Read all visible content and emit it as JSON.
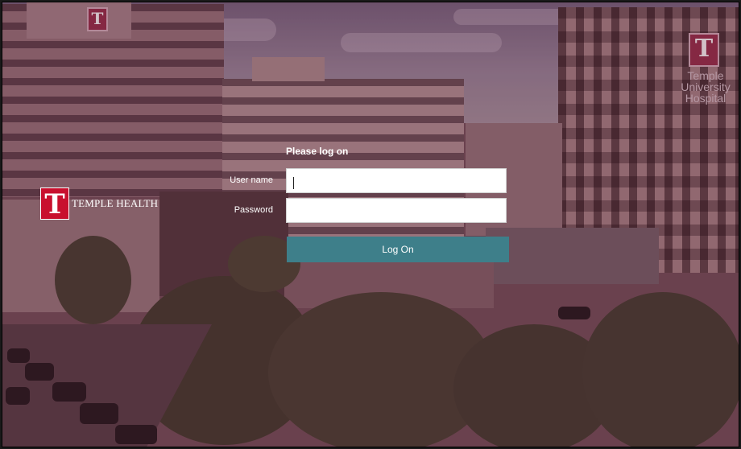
{
  "brand": {
    "logo_icon": "temple-t-logo-icon",
    "name": "TEMPLE HEALTH",
    "color": "#c8102e"
  },
  "background": {
    "building_sign": [
      "Temple",
      "University",
      "Hospital"
    ]
  },
  "login": {
    "title": "Please log on",
    "username_label": "User name",
    "username_value": "",
    "password_label": "Password",
    "password_value": "",
    "submit_label": "Log On",
    "submit_color": "#3e7f8a"
  }
}
